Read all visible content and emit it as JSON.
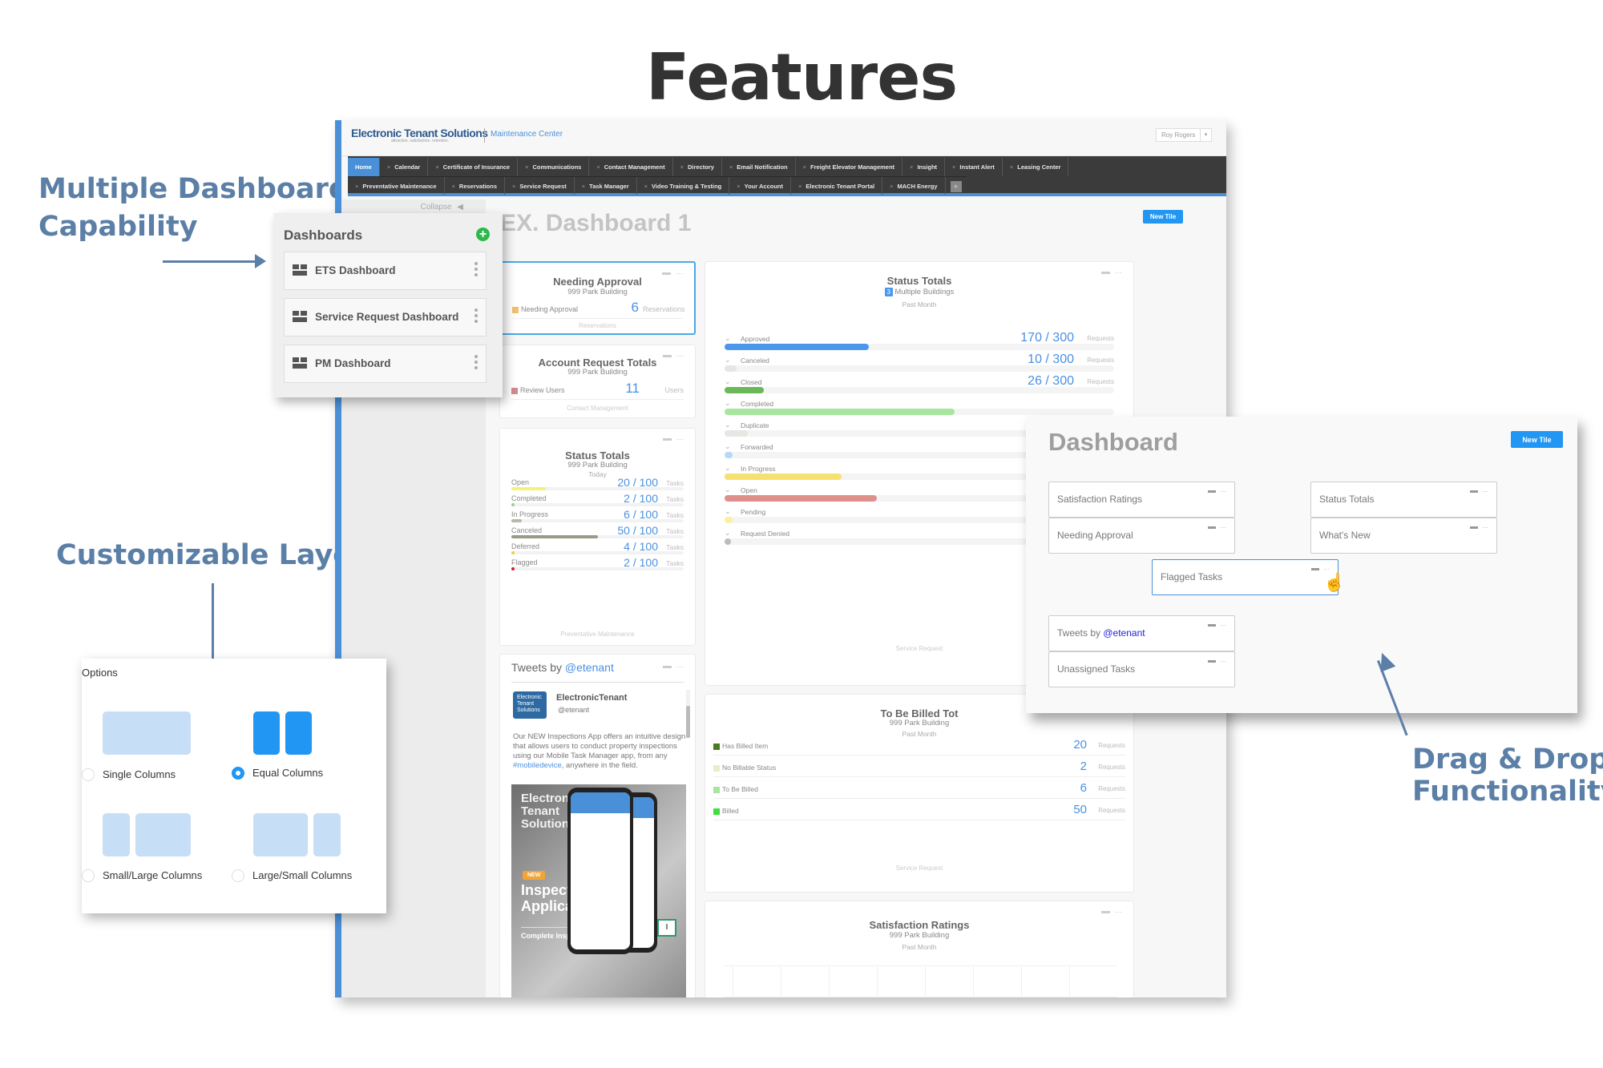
{
  "headline": "Features",
  "callouts": {
    "multiple_dashboard": [
      "Multiple Dashboard",
      "Capability"
    ],
    "customizable_layout": "Customizable Layout",
    "drag_drop": [
      "Drag & Drop",
      "Functionality"
    ]
  },
  "app": {
    "logo": "Electronic Tenant Solutions",
    "logo_tagline": "attraction. satisfaction. retention.",
    "section": "Maintenance Center",
    "user": "Roy Rogers",
    "nav_row1": [
      "Home",
      "Calendar",
      "Certificate of Insurance",
      "Communications",
      "Contact Management",
      "Directory",
      "Email Notification",
      "Freight Elevator Management",
      "Insight",
      "Instant Alert",
      "Leasing Center"
    ],
    "nav_row2": [
      "Preventative Maintenance",
      "Reservations",
      "Service Request",
      "Task Manager",
      "Video Training & Testing",
      "Your Account",
      "Electronic Tenant Portal",
      "MACH Energy"
    ],
    "nav_plus": "+",
    "collapse_label": "Collapse",
    "page_title": "EX. Dashboard 1",
    "new_tile": "New Tile"
  },
  "tiles": {
    "needing_approval": {
      "title": "Needing Approval",
      "building": "999 Park Building",
      "rows": [
        {
          "label": "Needing Approval",
          "value": "6",
          "unit": "Reservations",
          "color": "#f0c070"
        }
      ],
      "footer": "Reservations"
    },
    "account_requests": {
      "title": "Account Request Totals",
      "building": "999 Park Building",
      "rows": [
        {
          "label": "Review Users",
          "value": "11",
          "unit": "Users",
          "color": "#d08a8a"
        }
      ],
      "footer": "Contact Management"
    },
    "status_small": {
      "title": "Status Totals",
      "building": "999 Park Building",
      "period": "Today",
      "rows": [
        {
          "label": "Open",
          "value": "20 / 100",
          "unit": "Tasks",
          "pct": 0.2,
          "color": "#f6f17a"
        },
        {
          "label": "Completed",
          "value": "2 / 100",
          "unit": "Tasks",
          "pct": 0.02,
          "color": "#8fd88f"
        },
        {
          "label": "In Progress",
          "value": "6 / 100",
          "unit": "Tasks",
          "pct": 0.06,
          "color": "#b8b8a8"
        },
        {
          "label": "Canceled",
          "value": "50 / 100",
          "unit": "Tasks",
          "pct": 0.5,
          "color": "#9a9a8a"
        },
        {
          "label": "Deferred",
          "value": "4 / 100",
          "unit": "Tasks",
          "pct": 0.02,
          "color": "#f0d040"
        },
        {
          "label": "Flagged",
          "value": "2 / 100",
          "unit": "Tasks",
          "pct": 0.01,
          "color": "#d92020"
        }
      ],
      "footer": "Preventative Maintenance"
    },
    "tweets": {
      "title_prefix": "Tweets by ",
      "handle": "@etenant",
      "account_name": "ElectronicTenant",
      "account_handle": "@etenant",
      "avatar_text": "Electronic Tenant Solutions",
      "text": "Our NEW Inspections App offers an intuitive design that allows users to conduct property inspections using our Mobile Task Manager app, from any ",
      "hashtag": "#mobiledevice",
      "text_end": ", anywhere in the field.",
      "image_brand": "Electronic Tenant Solutions",
      "image_badge": "NEW",
      "image_headline": "Inspection Application",
      "image_tagline": "Complete Insp"
    },
    "status_big": {
      "title": "Status Totals",
      "building_count": "3",
      "building": "Multiple Buildings",
      "period": "Past Month",
      "rows": [
        {
          "label": "Approved",
          "value": "170 / 300",
          "unit": "Requests",
          "pct": 0.37,
          "color": "#4a98ee"
        },
        {
          "label": "Canceled",
          "value": "10 / 300",
          "unit": "Requests",
          "pct": 0.03,
          "color": "#e6e6e2"
        },
        {
          "label": "Closed",
          "value": "26 / 300",
          "unit": "Requests",
          "pct": 0.1,
          "color": "#6ab85a"
        },
        {
          "label": "Completed",
          "value": "",
          "unit": "",
          "pct": 0.59,
          "color": "#a8e6a0"
        },
        {
          "label": "Duplicate",
          "value": "",
          "unit": "",
          "pct": 0.06,
          "color": "#e6e6e2"
        },
        {
          "label": "Forwarded",
          "value": "",
          "unit": "",
          "pct": 0.02,
          "color": "#b8d8f8"
        },
        {
          "label": "In Progress",
          "value": "",
          "unit": "",
          "pct": 0.3,
          "color": "#f6e070"
        },
        {
          "label": "Open",
          "value": "",
          "unit": "",
          "pct": 0.39,
          "color": "#e0908a"
        },
        {
          "label": "Pending",
          "value": "",
          "unit": "",
          "pct": 0.02,
          "color": "#faf0a0"
        },
        {
          "label": "Request Denied",
          "value": "",
          "unit": "",
          "pct": 0.01,
          "color": "#bbbbbb"
        }
      ],
      "footer": "Service Request"
    },
    "to_be_billed": {
      "title": "To Be Billed Tot",
      "building": "999 Park Building",
      "period": "Past Month",
      "rows": [
        {
          "label": "Has Billed Item",
          "value": "20",
          "unit": "Requests",
          "color": "#4c7a1c"
        },
        {
          "label": "No Billable Status",
          "value": "2",
          "unit": "Requests",
          "color": "#ecebc8"
        },
        {
          "label": "To Be Billed",
          "value": "6",
          "unit": "Requests",
          "color": "#a8e6a0"
        },
        {
          "label": "Billed",
          "value": "50",
          "unit": "Requests",
          "color": "#3ee03e"
        }
      ],
      "footer": "Service Request"
    },
    "satisfaction": {
      "title": "Satisfaction Ratings",
      "building": "999 Park Building",
      "period": "Past Month"
    }
  },
  "dashboards_panel": {
    "title": "Dashboards",
    "items": [
      "ETS Dashboard",
      "Service Request Dashboard",
      "PM Dashboard"
    ]
  },
  "layout_options": {
    "title": "Options",
    "options": [
      {
        "label": "Single Columns",
        "selected": false
      },
      {
        "label": "Equal Columns",
        "selected": true
      },
      {
        "label": "Small/Large Columns",
        "selected": false
      },
      {
        "label": "Large/Small Columns",
        "selected": false
      }
    ]
  },
  "drag_drop": {
    "title": "Dashboard",
    "new_tile": "New Tile",
    "tiles": [
      "Satisfaction Ratings",
      "Status Totals",
      "Needing Approval",
      "What's New",
      "Flagged Tasks",
      "Tweets by ",
      "Unassigned Tasks"
    ],
    "tweets_handle": "@etenant"
  }
}
